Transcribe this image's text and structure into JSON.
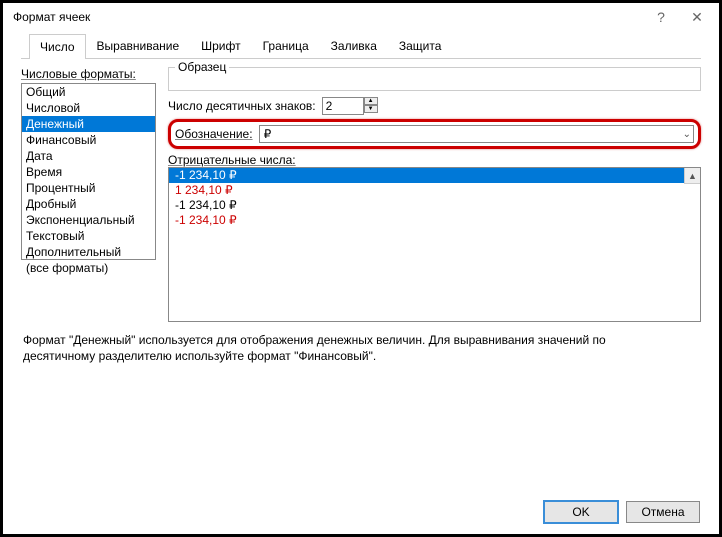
{
  "window": {
    "title": "Формат ячеек"
  },
  "tabs": {
    "items": [
      "Число",
      "Выравнивание",
      "Шрифт",
      "Граница",
      "Заливка",
      "Защита"
    ],
    "active": 0
  },
  "leftPanel": {
    "label": "Числовые форматы:",
    "items": [
      "Общий",
      "Числовой",
      "Денежный",
      "Финансовый",
      "Дата",
      "Время",
      "Процентный",
      "Дробный",
      "Экспоненциальный",
      "Текстовый",
      "Дополнительный",
      "(все форматы)"
    ],
    "selectedIndex": 2
  },
  "sample": {
    "label": "Образец"
  },
  "decimal": {
    "label": "Число десятичных знаков:",
    "value": "2"
  },
  "symbol": {
    "label": "Обозначение:",
    "value": "₽"
  },
  "negative": {
    "label": "Отрицательные числа:",
    "options": [
      {
        "text": "-1 234,10 ₽",
        "red": false,
        "sel": true
      },
      {
        "text": "1 234,10 ₽",
        "red": true,
        "sel": false
      },
      {
        "text": "-1 234,10 ₽",
        "red": false,
        "sel": false
      },
      {
        "text": "-1 234,10 ₽",
        "red": true,
        "sel": false
      }
    ]
  },
  "description": "Формат \"Денежный\" используется для отображения денежных величин. Для выравнивания значений по десятичному разделителю используйте формат \"Финансовый\".",
  "buttons": {
    "ok": "OK",
    "cancel": "Отмена"
  }
}
